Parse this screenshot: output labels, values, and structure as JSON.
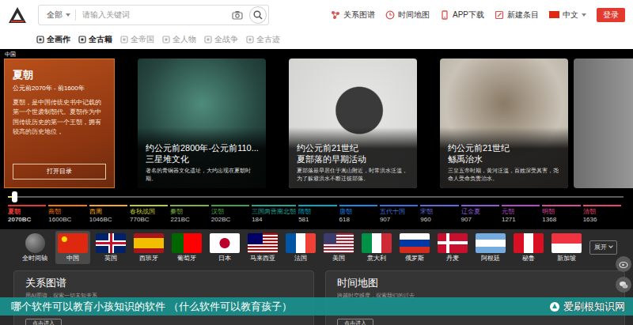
{
  "header": {
    "search": {
      "scope": "全部",
      "placeholder": "请输入关键词"
    },
    "links": [
      {
        "label": "关系图谱"
      },
      {
        "label": "时间地图"
      },
      {
        "label": "APP下载"
      },
      {
        "label": "新建条目"
      }
    ],
    "language": "中文",
    "login": "登录"
  },
  "categories": [
    {
      "label": "全画作",
      "disabled": false
    },
    {
      "label": "全古籍",
      "disabled": false
    },
    {
      "label": "全帝国",
      "disabled": true
    },
    {
      "label": "全人物",
      "disabled": true
    },
    {
      "label": "全战争",
      "disabled": true
    },
    {
      "label": "全古迹",
      "disabled": true
    }
  ],
  "region": "中国",
  "feature": {
    "title": "夏朝",
    "period": "公元前2070年 - 前1600年",
    "description": "夏朝，是中国传统史书中记载的第一个世袭制朝代。夏朝作为中国传统历史的第一个王朝，拥有较高的历史地位，",
    "button": "打开目录"
  },
  "slides": [
    {
      "date": "约公元前2800年-公元前110...",
      "title": "三星堆文化",
      "description": "著名的青铜器文化遗址，大约出现在夏朝时期。"
    },
    {
      "date": "约公元前21世纪",
      "title": "夏部落的早期活动",
      "description": "夏部落最早居住于嵩山附近，时常洪水泛滥，为了躲避洪水不断迁徙部落。"
    },
    {
      "date": "约公元前21世纪",
      "title": "鲧禹治水",
      "description": "三皇五帝时期，黄河泛滥，百姓深受其害，尧命人受命负责治水。"
    }
  ],
  "timeline": {
    "level": 0.01,
    "eras": [
      {
        "name": "夏朝",
        "year": "2070BC",
        "color": "#e53935",
        "selected": true
      },
      {
        "name": "商朝",
        "year": "1600BC",
        "color": "#f57c00",
        "selected": false
      },
      {
        "name": "西周",
        "year": "1046BC",
        "color": "#f9a825",
        "selected": false
      },
      {
        "name": "春秋战国",
        "year": "770BC",
        "color": "#c0ca33",
        "selected": false
      },
      {
        "name": "秦朝",
        "year": "221BC",
        "color": "#7cb342",
        "selected": false
      },
      {
        "name": "汉朝",
        "year": "202BC",
        "color": "#43a047",
        "selected": false
      },
      {
        "name": "三国两晋南北朝",
        "year": "184",
        "color": "#26a69a",
        "selected": false
      },
      {
        "name": "隋朝",
        "year": "581",
        "color": "#00acc1",
        "selected": false
      },
      {
        "name": "唐朝",
        "year": "618",
        "color": "#1e88e5",
        "selected": false
      },
      {
        "name": "五代十国",
        "year": "907",
        "color": "#3f6fd8",
        "selected": false
      },
      {
        "name": "宋朝",
        "year": "960",
        "color": "#5e6bd8",
        "selected": false
      },
      {
        "name": "辽金夏",
        "year": "907",
        "color": "#8e5ad8",
        "selected": false
      },
      {
        "name": "元朝",
        "year": "1271",
        "color": "#b04cc8",
        "selected": false
      },
      {
        "name": "明朝",
        "year": "1368",
        "color": "#d84a9a",
        "selected": false
      },
      {
        "name": "清朝",
        "year": "1636",
        "color": "#e5486a",
        "selected": false
      }
    ]
  },
  "countries": [
    {
      "name": "全时间轴",
      "selected": false
    },
    {
      "name": "中国",
      "selected": true
    },
    {
      "name": "英国",
      "selected": false
    },
    {
      "name": "西班牙",
      "selected": false
    },
    {
      "name": "葡萄牙",
      "selected": false
    },
    {
      "name": "日本",
      "selected": false
    },
    {
      "name": "马来西亚",
      "selected": false
    },
    {
      "name": "法国",
      "selected": false
    },
    {
      "name": "美国",
      "selected": false
    },
    {
      "name": "意大利",
      "selected": false
    },
    {
      "name": "俄罗斯",
      "selected": false
    },
    {
      "name": "丹麦",
      "selected": false
    },
    {
      "name": "阿根廷",
      "selected": false
    },
    {
      "name": "秘鲁",
      "selected": false
    },
    {
      "name": "新加坡",
      "selected": false
    }
  ],
  "expand": "展开",
  "panels": [
    {
      "title": "关系图谱",
      "subtitle": "用AI图谱，探索一切未知关系",
      "button": "点击进入"
    },
    {
      "title": "时间地图",
      "subtitle": "跨越时空维度，探索我们的过去",
      "button": "点击进入"
    }
  ],
  "caption": "哪个软件可以教育小孩知识的软件 （什么软件可以教育孩子）",
  "watermark": "爱刷根知识网"
}
